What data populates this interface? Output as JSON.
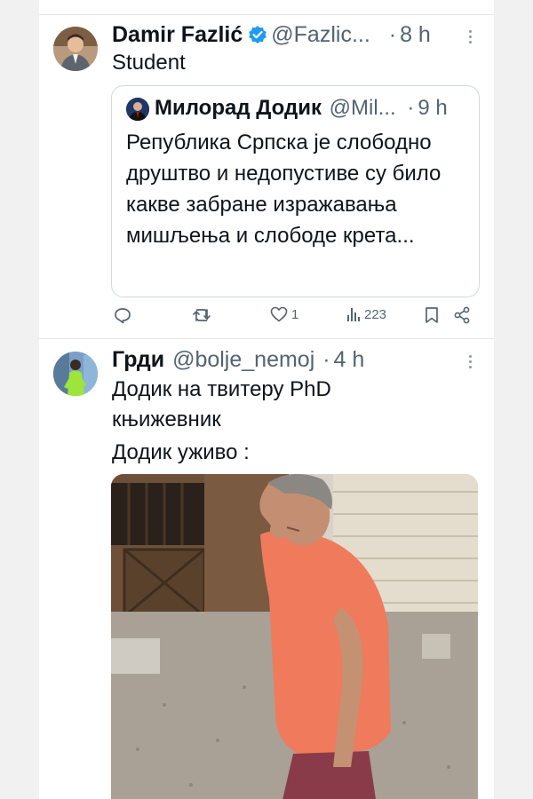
{
  "tweets": [
    {
      "author": {
        "name": "Damir Fazlić",
        "handle": "@Fazlic...",
        "verified": true
      },
      "time": "8 h",
      "text": "Student",
      "quote": {
        "author": {
          "name": "Милорад Додик",
          "handle": "@Mil..."
        },
        "time": "9 h",
        "text": "Република Српска је слободно друштво и недопустиве су било какве забране изражавања мишљења и слободе крета..."
      },
      "actions": {
        "likes": "1",
        "views": "223"
      }
    },
    {
      "author": {
        "name": "Грди",
        "handle": "@bolje_nemoj"
      },
      "time": "4 h",
      "text_lines": [
        "Додик на твитеру PhD",
        "књижевник",
        "Додик уживо :"
      ],
      "media": {
        "icon": "photo-man-in-orange-shirt"
      }
    }
  ],
  "separator": "·",
  "colors": {
    "text": "#0f1419",
    "muted": "#536471",
    "verified": "#1d9bf0",
    "border": "#cfd9de"
  }
}
